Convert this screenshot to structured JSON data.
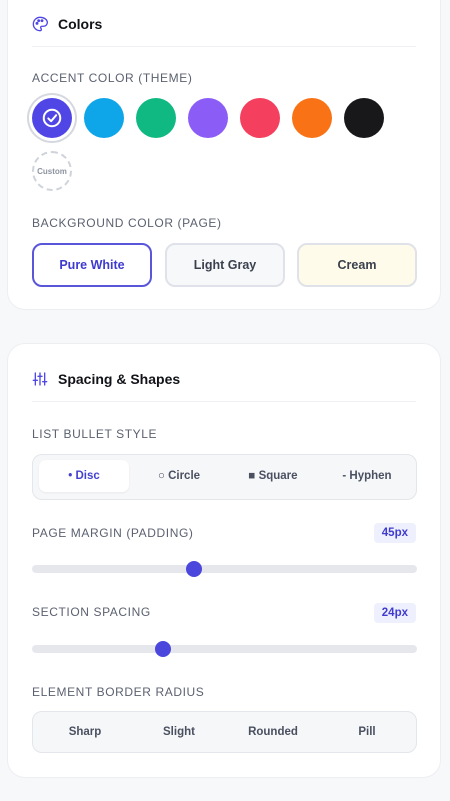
{
  "colors": {
    "title": "Colors",
    "accent_label": "ACCENT COLOR (THEME)",
    "accent_swatches": [
      {
        "name": "indigo",
        "color": "#4f46e5",
        "selected": true
      },
      {
        "name": "sky",
        "color": "#0ea5e9",
        "selected": false
      },
      {
        "name": "emerald",
        "color": "#10b981",
        "selected": false
      },
      {
        "name": "violet",
        "color": "#8b5cf6",
        "selected": false
      },
      {
        "name": "rose",
        "color": "#f43f5e",
        "selected": false
      },
      {
        "name": "orange",
        "color": "#f97316",
        "selected": false
      },
      {
        "name": "black",
        "color": "#18181b",
        "selected": false
      }
    ],
    "custom_label": "Custom",
    "background_label": "BACKGROUND COLOR (PAGE)",
    "background_options": [
      {
        "label": "Pure White",
        "color": "#ffffff",
        "active": true
      },
      {
        "label": "Light Gray",
        "color": "#f7f8fa",
        "active": false
      },
      {
        "label": "Cream",
        "color": "#fefbea",
        "active": false
      }
    ]
  },
  "spacing": {
    "title": "Spacing & Shapes",
    "bullet_label": "LIST BULLET STYLE",
    "bullet_options": [
      {
        "label": "• Disc",
        "active": true
      },
      {
        "label": "○ Circle",
        "active": false
      },
      {
        "label": "■ Square",
        "active": false
      },
      {
        "label": "- Hyphen",
        "active": false
      }
    ],
    "margin_label": "PAGE MARGIN (PADDING)",
    "margin_value": "45px",
    "margin_fraction": 0.42,
    "section_label": "SECTION SPACING",
    "section_value": "24px",
    "section_fraction": 0.34,
    "radius_label": "ELEMENT BORDER RADIUS",
    "radius_options": [
      {
        "label": "Sharp",
        "active": false
      },
      {
        "label": "Slight",
        "active": false
      },
      {
        "label": "Rounded",
        "active": false
      },
      {
        "label": "Pill",
        "active": false
      }
    ]
  },
  "theme": {
    "accent": "#4f46e5"
  }
}
